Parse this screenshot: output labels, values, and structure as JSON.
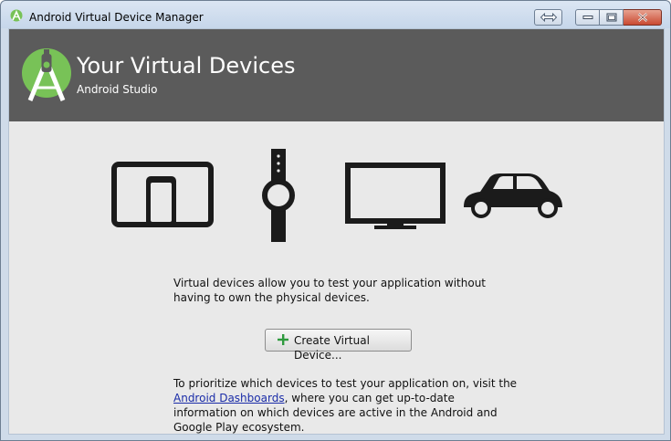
{
  "window": {
    "title": "Android Virtual Device Manager"
  },
  "banner": {
    "title": "Your Virtual Devices",
    "subtitle": "Android Studio"
  },
  "devices": {
    "icons": [
      "tablet-phone-icon",
      "watch-icon",
      "tv-icon",
      "car-icon"
    ]
  },
  "main": {
    "description": "Virtual devices allow you to test your application without having to own the physical devices.",
    "create_button": "Create Virtual Device...",
    "hint_before": "To prioritize which devices to test your application on, visit the",
    "hint_link": "Android Dashboards",
    "hint_after": ", where you can get up-to-date information on which devices are active in the Android and Google Play ecosystem."
  },
  "colors": {
    "banner": "#5b5b5b",
    "logo_green": "#78c257",
    "plus_green": "#2e9a3e"
  }
}
